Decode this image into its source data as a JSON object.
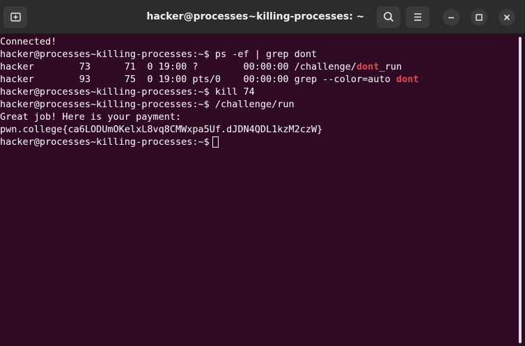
{
  "window": {
    "title": "hacker@processes~killing-processes: ~"
  },
  "titlebar": {
    "buttons": [
      "new-tab",
      "search",
      "menu",
      "minimize",
      "maximize",
      "close"
    ]
  },
  "terminal": {
    "lines": [
      {
        "text": "Connected!"
      },
      {
        "text": "hacker@processes~killing-processes:~$ ps -ef | grep dont"
      },
      {
        "pre": "hacker        73      71  0 19:00 ?        00:00:00 /challenge/",
        "match": "dont",
        "post": "_run"
      },
      {
        "pre": "hacker        93      75  0 19:00 pts/0    00:00:00 grep --color=auto ",
        "match": "dont",
        "post": ""
      },
      {
        "text": "hacker@processes~killing-processes:~$ kill 74"
      },
      {
        "text": "hacker@processes~killing-processes:~$ /challenge/run"
      },
      {
        "text": "Great job! Here is your payment:"
      },
      {
        "text": "pwn.college{ca6LODUmOKelxL8vq8CMWxpa5Uf.dJDN4QDL1kzM2czW}"
      },
      {
        "text": "hacker@processes~killing-processes:~$"
      }
    ]
  },
  "colors": {
    "terminal_bg": "#300a24",
    "titlebar_bg": "#2c2c2c",
    "grep_match": "#e5484d",
    "text": "#ffffff"
  }
}
